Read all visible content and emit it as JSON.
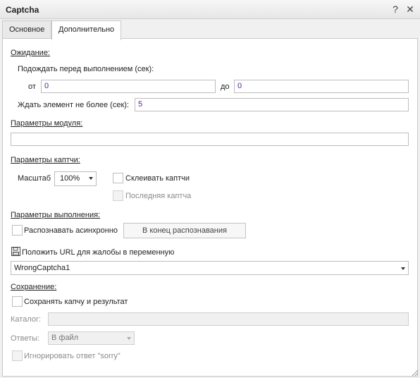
{
  "window": {
    "title": "Captcha",
    "help_icon": "?",
    "close_icon": "✕"
  },
  "tabs": [
    {
      "label": "Основное",
      "active": false
    },
    {
      "label": "Дополнительно",
      "active": true
    }
  ],
  "wait": {
    "section": "Ожидание:",
    "before_label": "Подождать перед выполнением (сек):",
    "from_label": "от",
    "from_value": "0",
    "to_label": "до",
    "to_value": "0",
    "element_label": "Ждать элемент не более (сек):",
    "element_value": "5"
  },
  "module": {
    "section": "Параметры модуля:",
    "value": ""
  },
  "captcha": {
    "section": "Параметры каптчи:",
    "scale_label": "Масштаб",
    "scale_value": "100%",
    "glue_label": "Склеивать каптчи",
    "last_label": "Последняя каптча"
  },
  "execution": {
    "section": "Параметры выполнения:",
    "async_label": "Распознавать асинхронно",
    "end_button": "В конец распознавания",
    "url_label": "Положить URL для жалобы в переменную",
    "url_value": "WrongCaptcha1"
  },
  "saving": {
    "section": "Сохранение:",
    "save_label": "Сохранять капчу и результат",
    "catalog_label": "Каталог:",
    "catalog_value": "",
    "answers_label": "Ответы:",
    "answers_value": "В файл",
    "ignore_label": "Игнорировать ответ \"sorry\""
  },
  "colors": {
    "accent_value": "#5a1c9c",
    "panel_bg": "#ffffff",
    "window_bg": "#f0f0f0"
  }
}
